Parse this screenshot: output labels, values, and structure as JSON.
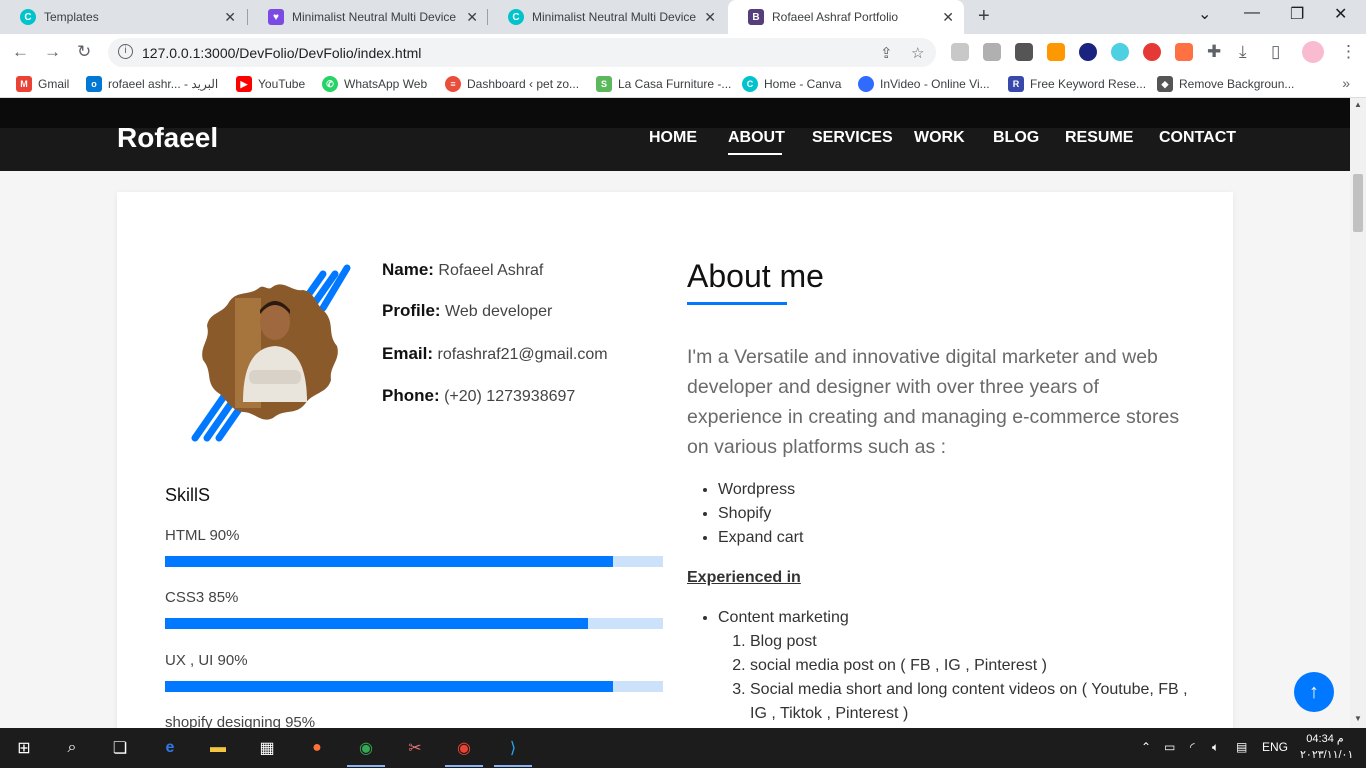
{
  "browser": {
    "tabs": [
      {
        "title": "Templates",
        "icon": "canva-icon"
      },
      {
        "title": "Minimalist Neutral Multi Device",
        "icon": "heart-icon"
      },
      {
        "title": "Minimalist Neutral Multi Device",
        "icon": "canva-icon"
      },
      {
        "title": "Rofaeel Ashraf Portfolio",
        "icon": "bootstrap-icon"
      }
    ],
    "url": "127.0.0.1:3000/DevFolio/DevFolio/index.html",
    "bookmarks": [
      {
        "label": "Gmail",
        "color": "#ea4335"
      },
      {
        "label": "rofaeel ashr... - البريد",
        "color": "#0078d4"
      },
      {
        "label": "YouTube",
        "color": "#ff0000"
      },
      {
        "label": "WhatsApp Web",
        "color": "#25d366"
      },
      {
        "label": "Dashboard ‹ pet zo...",
        "color": "#e94e3c"
      },
      {
        "label": "La Casa Furniture -...",
        "color": "#5cb85c"
      },
      {
        "label": "Home - Canva",
        "color": "#00c4cc"
      },
      {
        "label": "InVideo - Online Vi...",
        "color": "#2f6bff"
      },
      {
        "label": "Free Keyword Rese...",
        "color": "#3949ab"
      },
      {
        "label": "Remove Backgroun...",
        "color": "#555555"
      }
    ]
  },
  "site": {
    "brand": "Rofaeel",
    "menu": [
      "HOME",
      "ABOUT",
      "SERVICES",
      "WORK",
      "BLOG",
      "RESUME",
      "CONTACT"
    ],
    "active_menu": "ABOUT",
    "profile": {
      "name_label": "Name:",
      "name": "Rofaeel Ashraf",
      "profile_label": "Profile:",
      "profile": "Web developer",
      "email_label": "Email:",
      "email": "rofashraf21@gmail.com",
      "phone_label": "Phone:",
      "phone": "(+20) 1273938697"
    },
    "skills_title": "SkillS",
    "skills": [
      {
        "label": "HTML 90%",
        "value": 90
      },
      {
        "label": "CSS3 85%",
        "value": 85
      },
      {
        "label": "UX , UI 90%",
        "value": 90
      },
      {
        "label": "shopify designing 95%",
        "value": 95
      }
    ],
    "about_title": "About me",
    "about_text": "I'm a Versatile and innovative digital marketer and web developer and designer with over three years of experience in creating and managing e-commerce stores on various platforms such as :",
    "platforms": [
      "Wordpress",
      "Shopify",
      "Expand cart"
    ],
    "experienced_title": "Experienced in",
    "experience": {
      "item": "Content marketing",
      "sub": [
        "Blog post",
        "social media post on ( FB , IG , Pinterest )",
        "Social media short and long content videos on ( Youtube, FB , IG , Tiktok , Pinterest )"
      ]
    },
    "accent_color": "#0078ff"
  },
  "taskbar": {
    "language": "ENG",
    "time": "04:34 م",
    "date": "٢٠٢٣/١١/٠١"
  }
}
